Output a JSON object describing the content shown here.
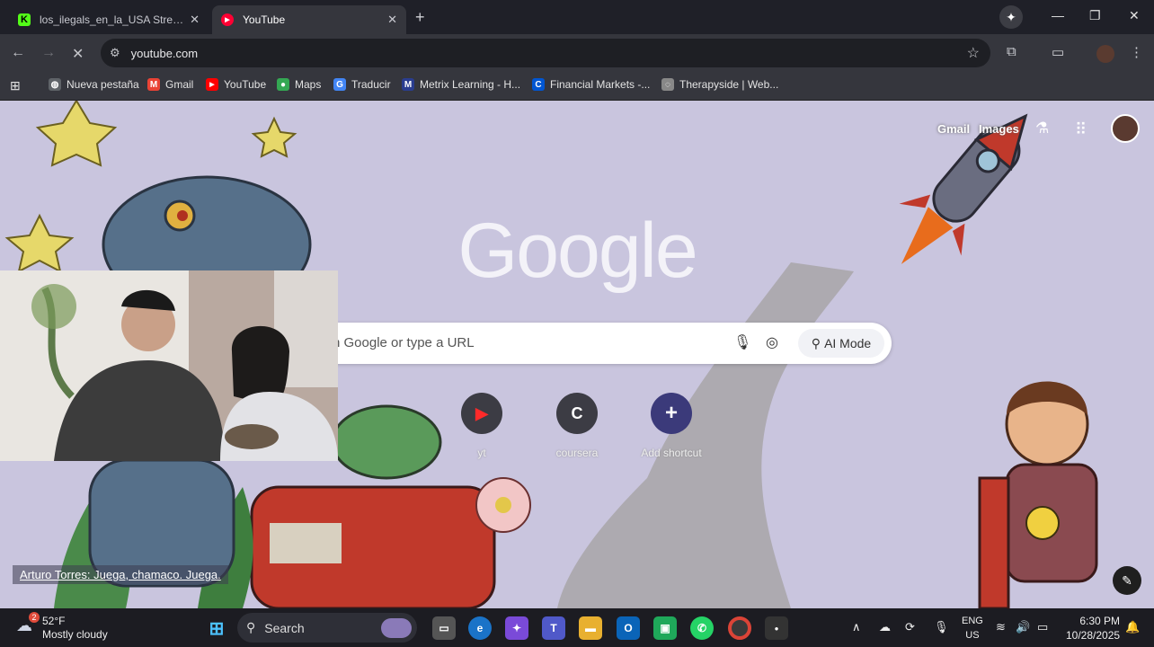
{
  "tabs": [
    {
      "title": "los_ilegals_en_la_USA Stream - ‘",
      "favicon": "K",
      "color": "#53fc18",
      "active": false
    },
    {
      "title": "YouTube",
      "favicon": "▶",
      "color": "#ff0033",
      "active": true
    }
  ],
  "omnibox": {
    "url": "youtube.com"
  },
  "bookmarks": [
    {
      "label": "Nueva pestaña",
      "icon": "globe-icon",
      "color": "#5f6368"
    },
    {
      "label": "Gmail",
      "icon": "gmail-icon",
      "color": "#ea4335"
    },
    {
      "label": "YouTube",
      "icon": "youtube-icon",
      "color": "#ff0000"
    },
    {
      "label": "Maps",
      "icon": "maps-icon",
      "color": "#34a853"
    },
    {
      "label": "Traducir",
      "icon": "translate-icon",
      "color": "#4285f4"
    },
    {
      "label": "Metrix Learning - H...",
      "icon": "metrix-icon",
      "color": "#2a3d8f"
    },
    {
      "label": "Financial Markets -...",
      "icon": "coursera-icon",
      "color": "#0056d2"
    },
    {
      "label": "Therapyside | Web...",
      "icon": "therapyside-icon",
      "color": "#888888"
    }
  ],
  "ntp": {
    "logo": "Google",
    "gmail": "Gmail",
    "images": "Images",
    "search_placeholder": "h Google or type a URL",
    "ai_mode": "AI Mode",
    "shortcuts": [
      {
        "label": "yt",
        "glyph": "▶",
        "bg": "#3c3c44",
        "fg": "#ff2a2a"
      },
      {
        "label": "coursera",
        "glyph": "C",
        "bg": "#3c3c44",
        "fg": "#ffffff"
      },
      {
        "label": "Add shortcut",
        "glyph": "+",
        "bg": "#3b3a7a",
        "fg": "#ffffff"
      }
    ],
    "caption": "Arturo Torres: Juega, chamaco. Juega."
  },
  "taskbar": {
    "weather_temp": "52°F",
    "weather_desc": "Mostly cloudy",
    "weather_badge": "2",
    "search_label": "Search",
    "lang_1": "ENG",
    "lang_2": "US",
    "time": "6:30 PM",
    "date": "10/28/2025"
  },
  "colors": {
    "ntp_bg": "#c9c5de",
    "toolbar": "#35363d",
    "tabstrip": "#1f2028"
  }
}
